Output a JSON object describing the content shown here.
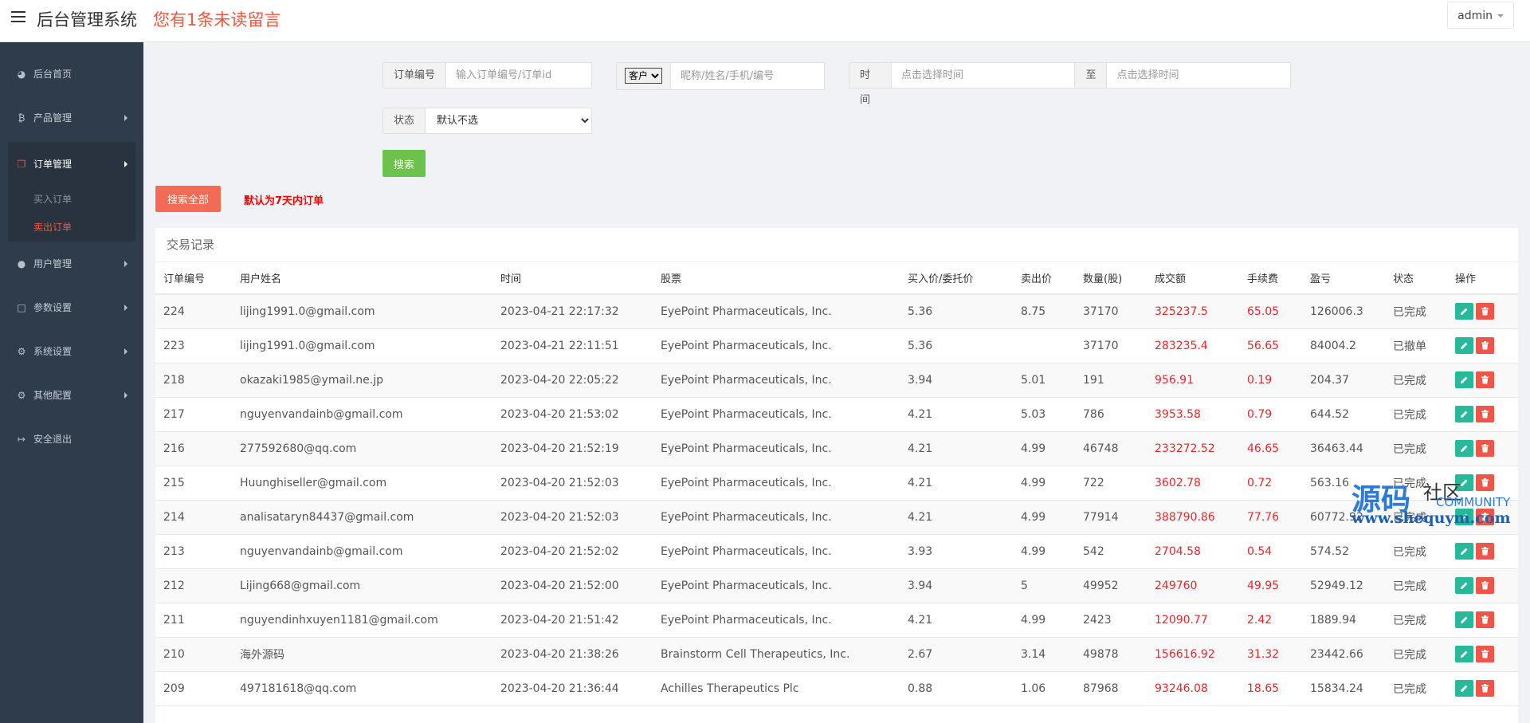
{
  "header": {
    "title": "后台管理系统",
    "unread_notice": "您有1条未读留言",
    "user": "admin"
  },
  "sidebar": {
    "items": [
      {
        "icon": "dashboard-icon",
        "label": "后台首页"
      },
      {
        "icon": "bitcoin-icon",
        "label": "产品管理"
      },
      {
        "icon": "copy-icon",
        "label": "订单管理",
        "active": true
      },
      {
        "icon": "user-icon",
        "label": "用户管理"
      },
      {
        "icon": "file-icon",
        "label": "参数设置"
      },
      {
        "icon": "cogs-icon",
        "label": "系统设置"
      },
      {
        "icon": "gear-icon",
        "label": "其他配置"
      },
      {
        "icon": "sign-out-icon",
        "label": "安全退出"
      }
    ],
    "sub_items": [
      {
        "label": "买入订单",
        "current": false
      },
      {
        "label": "卖出订单",
        "current": true
      }
    ]
  },
  "filters": {
    "order_label": "订单编号",
    "order_placeholder": "输入订单编号/订单id",
    "customer_select": "客户",
    "customer_placeholder": "昵称/姓名/手机/编号",
    "time_label": "时间",
    "time_start_placeholder": "点击选择时间",
    "to_label": "至",
    "time_end_placeholder": "点击选择时间",
    "status_label": "状态",
    "status_value": "默认不选",
    "search_button": "搜索",
    "search_all_button": "搜索全部",
    "default_note": "默认为7天内订单"
  },
  "table": {
    "title": "交易记录",
    "columns": [
      "订单编号",
      "用户姓名",
      "时间",
      "股票",
      "买入价/委托价",
      "卖出价",
      "数量(股)",
      "成交额",
      "手续费",
      "盈亏",
      "状态",
      "操作"
    ],
    "rows": [
      [
        "224",
        "lijing1991.0@gmail.com",
        "2023-04-21 22:17:32",
        "EyePoint Pharmaceuticals, Inc.",
        "5.36",
        "8.75",
        "37170",
        "325237.5",
        "65.05",
        "126006.3",
        "已完成"
      ],
      [
        "223",
        "lijing1991.0@gmail.com",
        "2023-04-21 22:11:51",
        "EyePoint Pharmaceuticals, Inc.",
        "5.36",
        "",
        "37170",
        "283235.4",
        "56.65",
        "84004.2",
        "已撤单"
      ],
      [
        "218",
        "okazaki1985@ymail.ne.jp",
        "2023-04-20 22:05:22",
        "EyePoint Pharmaceuticals, Inc.",
        "3.94",
        "5.01",
        "191",
        "956.91",
        "0.19",
        "204.37",
        "已完成"
      ],
      [
        "217",
        "nguyenvandainb@gmail.com",
        "2023-04-20 21:53:02",
        "EyePoint Pharmaceuticals, Inc.",
        "4.21",
        "5.03",
        "786",
        "3953.58",
        "0.79",
        "644.52",
        "已完成"
      ],
      [
        "216",
        "277592680@qq.com",
        "2023-04-20 21:52:19",
        "EyePoint Pharmaceuticals, Inc.",
        "4.21",
        "4.99",
        "46748",
        "233272.52",
        "46.65",
        "36463.44",
        "已完成"
      ],
      [
        "215",
        "Huunghiseller@gmail.com",
        "2023-04-20 21:52:03",
        "EyePoint Pharmaceuticals, Inc.",
        "4.21",
        "4.99",
        "722",
        "3602.78",
        "0.72",
        "563.16",
        "已完成"
      ],
      [
        "214",
        "analisataryn84437@gmail.com",
        "2023-04-20 21:52:03",
        "EyePoint Pharmaceuticals, Inc.",
        "4.21",
        "4.99",
        "77914",
        "388790.86",
        "77.76",
        "60772.92",
        "已完成"
      ],
      [
        "213",
        "nguyenvandainb@gmail.com",
        "2023-04-20 21:52:02",
        "EyePoint Pharmaceuticals, Inc.",
        "3.93",
        "4.99",
        "542",
        "2704.58",
        "0.54",
        "574.52",
        "已完成"
      ],
      [
        "212",
        "Lijing668@gmail.com",
        "2023-04-20 21:52:00",
        "EyePoint Pharmaceuticals, Inc.",
        "3.94",
        "5",
        "49952",
        "249760",
        "49.95",
        "52949.12",
        "已完成"
      ],
      [
        "211",
        "nguyendinhxuyen1181@gmail.com",
        "2023-04-20 21:51:42",
        "EyePoint Pharmaceuticals, Inc.",
        "4.21",
        "4.99",
        "2423",
        "12090.77",
        "2.42",
        "1889.94",
        "已完成"
      ],
      [
        "210",
        "海外源码",
        "2023-04-20 21:38:26",
        "Brainstorm Cell Therapeutics, Inc.",
        "2.67",
        "3.14",
        "49878",
        "156616.92",
        "31.32",
        "23442.66",
        "已完成"
      ],
      [
        "209",
        "497181618@qq.com",
        "2023-04-20 21:36:44",
        "Achilles Therapeutics Plc",
        "0.88",
        "1.06",
        "87968",
        "93246.08",
        "18.65",
        "15834.24",
        "已完成"
      ]
    ]
  },
  "watermark": {
    "main": "源码",
    "she": "社区",
    "community": "COMMUNITY",
    "url": "www.shequym.com"
  }
}
